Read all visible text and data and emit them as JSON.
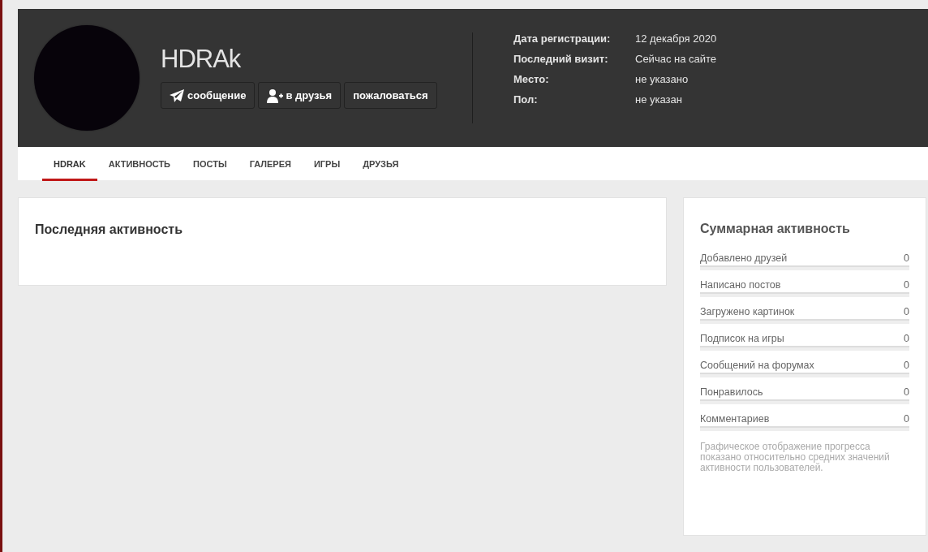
{
  "profile": {
    "username": "HDRAk",
    "buttons": [
      {
        "kind": "message",
        "label": "сообщение"
      },
      {
        "kind": "friend",
        "label": "в друзья"
      },
      {
        "kind": "report",
        "label": "пожаловаться"
      }
    ],
    "info": [
      {
        "label": "Дата регистрации:",
        "value": "12 декабря 2020"
      },
      {
        "label": "Последний визит:",
        "value": "Сейчас на сайте"
      },
      {
        "label": "Место:",
        "value": "не указано"
      },
      {
        "label": "Пол:",
        "value": "не указан"
      }
    ]
  },
  "tabs": [
    {
      "label": "HDRAK",
      "selected": true
    },
    {
      "label": "АКТИВНОСТЬ",
      "selected": false
    },
    {
      "label": "ПОСТЫ",
      "selected": false
    },
    {
      "label": "ГАЛЕРЕЯ",
      "selected": false
    },
    {
      "label": "ИГРЫ",
      "selected": false
    },
    {
      "label": "ДРУЗЬЯ",
      "selected": false
    }
  ],
  "recent_activity": {
    "title": "Последняя активность"
  },
  "summary": {
    "title": "Суммарная активность",
    "stats": [
      {
        "label": "Добавлено друзей",
        "value": "0",
        "level": 0
      },
      {
        "label": "Написано постов",
        "value": "0",
        "level": 0
      },
      {
        "label": "Загружено картинок",
        "value": "0",
        "level": 0
      },
      {
        "label": "Подписок на игры",
        "value": "0",
        "level": 0
      },
      {
        "label": "Сообщений на форумах",
        "value": "0",
        "level": 0
      },
      {
        "label": "Понравилось",
        "value": "0",
        "level": 0
      },
      {
        "label": "Комментариев",
        "value": "0",
        "level": 0
      }
    ],
    "note": "Графическое отображение прогресса показано относительно средних значений активности пользователей."
  }
}
